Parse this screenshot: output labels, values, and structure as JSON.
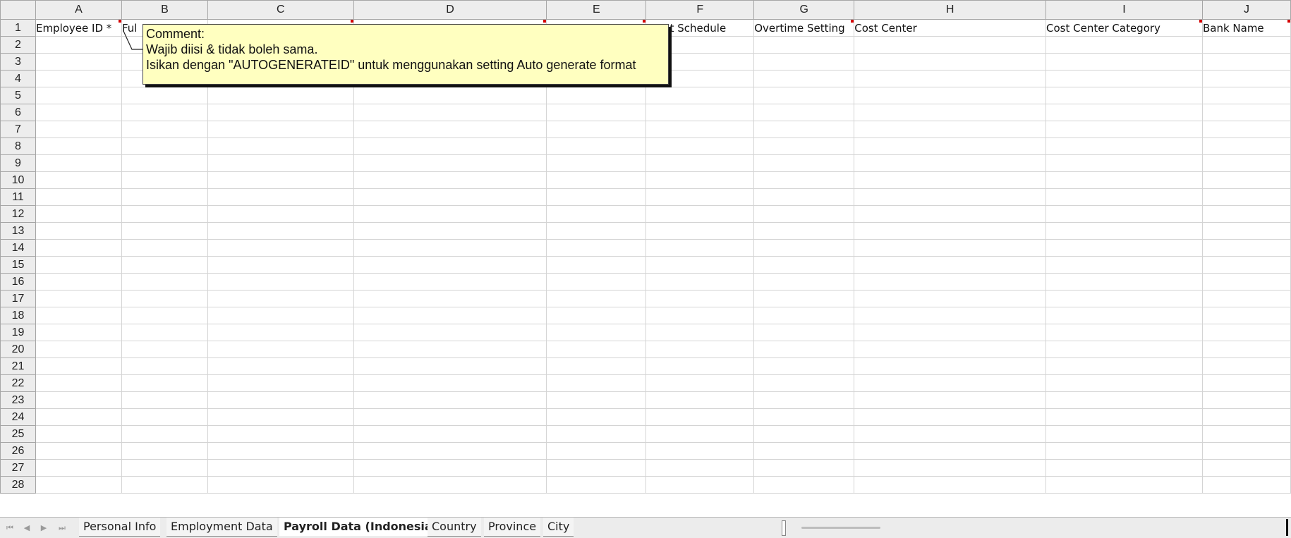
{
  "columns": [
    "A",
    "B",
    "C",
    "D",
    "E",
    "F",
    "G",
    "H",
    "I",
    "J"
  ],
  "header_row": {
    "A": "Employee ID *",
    "B": "Ful",
    "C": "",
    "D": "",
    "E": "",
    "F": "ment Schedule",
    "G": "Overtime Setting",
    "H": "Cost Center",
    "I": "Cost Center Category",
    "J": "Bank Name"
  },
  "row_numbers": [
    "1",
    "2",
    "3",
    "4",
    "5",
    "6",
    "7",
    "8",
    "9",
    "10",
    "11",
    "12",
    "13",
    "14",
    "15",
    "16",
    "17",
    "18",
    "19",
    "20",
    "21",
    "22",
    "23",
    "24",
    "25",
    "26",
    "27",
    "28"
  ],
  "comment": {
    "title": "Comment:",
    "line1": "Wajib diisi & tidak boleh sama.",
    "line2": "Isikan dengan \"AUTOGENERATEID\" untuk menggunakan setting Auto generate format"
  },
  "tabs": {
    "nav_first": "⏮",
    "nav_prev": "◀",
    "nav_next": "▶",
    "nav_last": "⏭",
    "personal_info": "Personal Info",
    "employment_data": "Employment Data",
    "payroll_data": "Payroll Data (Indonesia)",
    "country": "Country",
    "province": "Province",
    "city": "City",
    "active": "Payroll Data (Indonesia)"
  },
  "colors": {
    "comment_bg": "#ffffc0",
    "comment_marker": "#d40000",
    "header_bg": "#ededed",
    "grid_line": "#d4d4d4"
  }
}
